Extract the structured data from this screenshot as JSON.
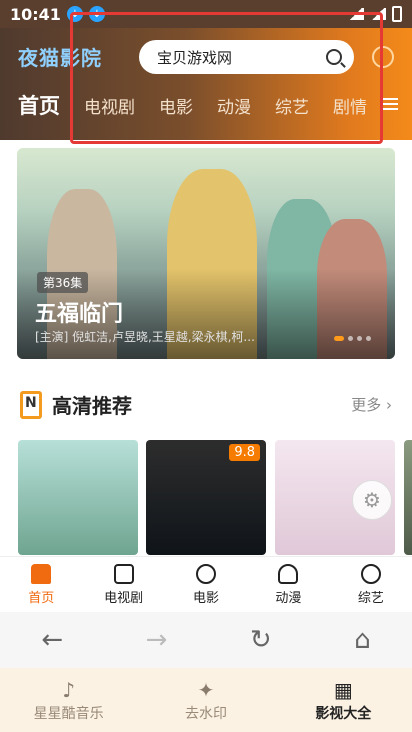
{
  "status": {
    "time": "10:41"
  },
  "header": {
    "logo": "夜猫影院",
    "search_text": "宝贝游戏网",
    "tabs": [
      {
        "label": "首页",
        "active": true
      },
      {
        "label": "电视剧"
      },
      {
        "label": "电影"
      },
      {
        "label": "动漫"
      },
      {
        "label": "综艺"
      },
      {
        "label": "剧情"
      }
    ]
  },
  "banner": {
    "episode": "第36集",
    "title": "五福临门",
    "cast": "[主演] 倪虹洁,卢昱晓,王星越,梁永棋,柯..."
  },
  "section": {
    "title": "高清推荐",
    "more": "更多"
  },
  "posters": [
    {
      "name": "poster-1"
    },
    {
      "name": "poster-2",
      "score": "9.8"
    },
    {
      "name": "poster-3"
    },
    {
      "name": "poster-4"
    }
  ],
  "bottom_nav": [
    {
      "label": "首页",
      "icon": "home-icon",
      "active": true
    },
    {
      "label": "电视剧",
      "icon": "tv-icon"
    },
    {
      "label": "电影",
      "icon": "film-reel-icon"
    },
    {
      "label": "动漫",
      "icon": "anime-icon"
    },
    {
      "label": "综艺",
      "icon": "variety-icon"
    }
  ],
  "browser_toolbar": [
    "back-icon",
    "forward-icon",
    "refresh-icon",
    "home-icon"
  ],
  "outer_bar": [
    {
      "label": "星星酷音乐",
      "icon": "music-note-icon"
    },
    {
      "label": "去水印",
      "icon": "magic-wand-icon"
    },
    {
      "label": "影视大全",
      "icon": "grid-icon",
      "active": true
    }
  ]
}
